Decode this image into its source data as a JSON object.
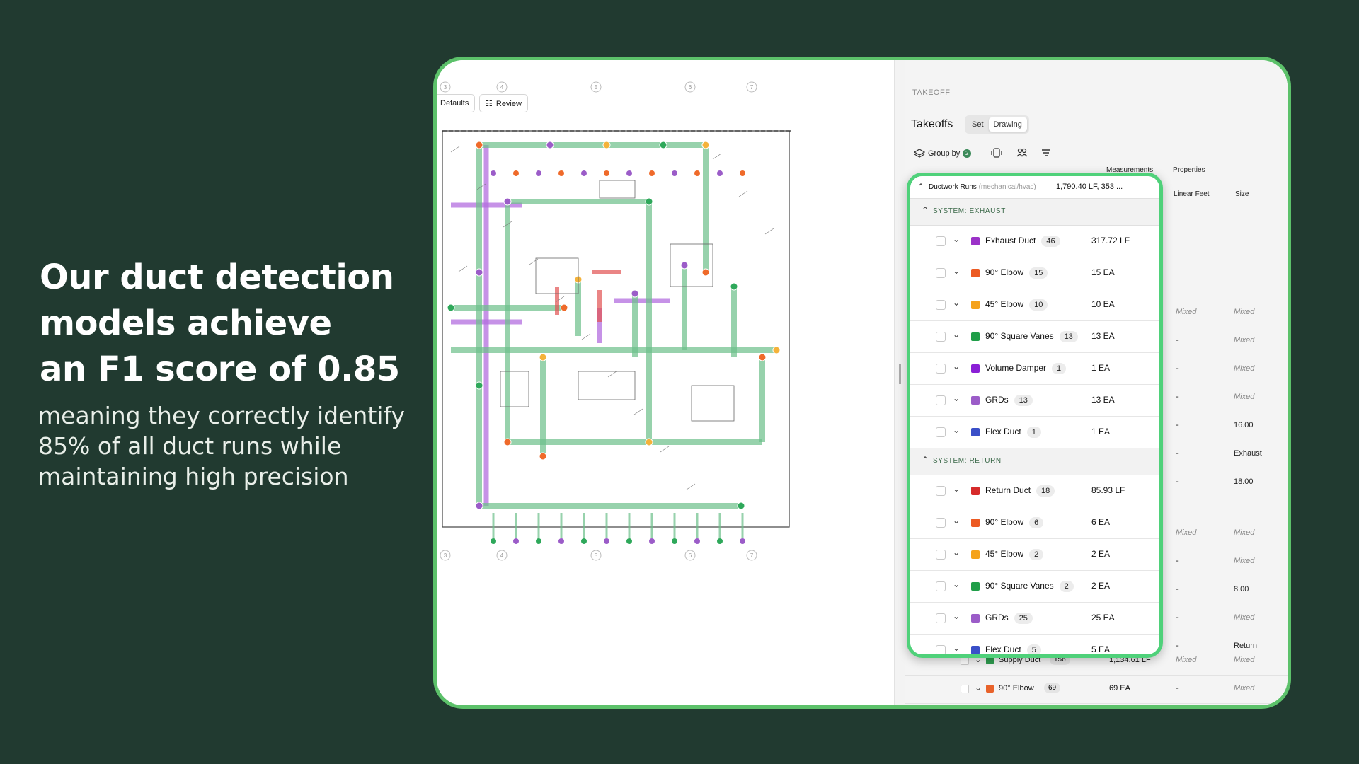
{
  "colors": {
    "background": "#213a30",
    "frame_border": "#5cc16a",
    "card_border": "#4fd17a"
  },
  "headline": [
    "Our duct detection",
    "models achieve",
    "an F1 score of 0.85"
  ],
  "subline": [
    "meaning they correctly identify",
    "85% of all duct runs while",
    "maintaining high precision"
  ],
  "drawing": {
    "defaults_label": "Defaults",
    "review_label": "Review",
    "grid_numbers": [
      "3",
      "4",
      "5",
      "6",
      "7"
    ]
  },
  "panel": {
    "section_label": "TAKEOFF",
    "title": "Takeoffs",
    "view_tabs": [
      "Set",
      "Drawing"
    ],
    "group_by_label": "Group by",
    "group_by_count": "2",
    "columns": {
      "measurements": "Measurements",
      "properties": "Properties",
      "linear_feet": "Linear Feet",
      "size": "Size"
    },
    "bg_rows": [
      {
        "lf": "Mixed",
        "size": "Mixed"
      },
      {
        "lf": "-",
        "size": "Mixed"
      },
      {
        "lf": "-",
        "size": "Mixed"
      },
      {
        "lf": "-",
        "size": "Mixed"
      },
      {
        "lf": "-",
        "size": "16.00"
      },
      {
        "lf": "-",
        "size": "Exhaust"
      },
      {
        "lf": "-",
        "size": "18.00"
      },
      {
        "lf": "Mixed",
        "size": "Mixed"
      },
      {
        "lf": "-",
        "size": "Mixed"
      },
      {
        "lf": "-",
        "size": "8.00"
      },
      {
        "lf": "-",
        "size": "Mixed"
      },
      {
        "lf": "-",
        "size": "Return"
      },
      {
        "lf": "-",
        "size": "Mixed"
      }
    ],
    "bottom_rows": [
      {
        "name": "Supply Duct",
        "count": "156",
        "measure": "1,134.61 LF",
        "lf": "Mixed",
        "size": "Mixed",
        "color": "#2e9d4f"
      },
      {
        "name": "90° Elbow",
        "count": "69",
        "measure": "69 EA",
        "lf": "-",
        "size": "Mixed",
        "color": "#e8622a"
      }
    ]
  },
  "card": {
    "group_name": "Ductwork Runs",
    "group_sub": "(mechanical/hvac)",
    "group_total": "1,790.40 LF, 353 ...",
    "systems": [
      {
        "label": "SYSTEM: EXHAUST",
        "items": [
          {
            "name": "Exhaust Duct",
            "count": "46",
            "measure": "317.72 LF",
            "color": "#9b32c8"
          },
          {
            "name": "90° Elbow",
            "count": "15",
            "measure": "15 EA",
            "color": "#ec5a22"
          },
          {
            "name": "45° Elbow",
            "count": "10",
            "measure": "10 EA",
            "color": "#f5a21a"
          },
          {
            "name": "90° Square Vanes",
            "count": "13",
            "measure": "13 EA",
            "color": "#1f9e48"
          },
          {
            "name": "Volume Damper",
            "count": "1",
            "measure": "1 EA",
            "color": "#8a1fd6"
          },
          {
            "name": "GRDs",
            "count": "13",
            "measure": "13 EA",
            "color": "#9b5cc8"
          },
          {
            "name": "Flex Duct",
            "count": "1",
            "measure": "1 EA",
            "color": "#3a4fc8"
          }
        ]
      },
      {
        "label": "SYSTEM: RETURN",
        "items": [
          {
            "name": "Return Duct",
            "count": "18",
            "measure": "85.93 LF",
            "color": "#d62a2a"
          },
          {
            "name": "90° Elbow",
            "count": "6",
            "measure": "6 EA",
            "color": "#ec5a22"
          },
          {
            "name": "45° Elbow",
            "count": "2",
            "measure": "2 EA",
            "color": "#f5a21a"
          },
          {
            "name": "90° Square Vanes",
            "count": "2",
            "measure": "2 EA",
            "color": "#1f9e48"
          },
          {
            "name": "GRDs",
            "count": "25",
            "measure": "25 EA",
            "color": "#9b5cc8"
          },
          {
            "name": "Flex Duct",
            "count": "5",
            "measure": "5 EA",
            "color": "#3a4fc8"
          }
        ]
      }
    ]
  }
}
